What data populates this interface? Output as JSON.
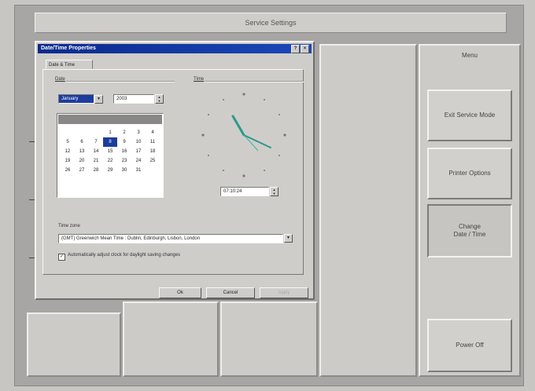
{
  "screen": {
    "title": "Service Settings"
  },
  "right_menu": {
    "header": "Menu",
    "buttons": [
      {
        "id": "exit",
        "label": "Exit Service Mode"
      },
      {
        "id": "printer",
        "label": "Printer Options"
      },
      {
        "id": "datetime",
        "label": "Change\nDate / Time"
      },
      {
        "id": "power",
        "label": "Power Off"
      }
    ]
  },
  "dialog": {
    "title": "Date/Time Properties",
    "controls": {
      "help": "?",
      "close": "×"
    },
    "tab": "Date & Time",
    "date_group": "Date",
    "time_group": "Time",
    "month": "January",
    "year": "2003",
    "calendar": {
      "days": [
        "",
        "",
        "",
        "1",
        "2",
        "3",
        "4",
        "5",
        "6",
        "7",
        "8",
        "9",
        "10",
        "11",
        "12",
        "13",
        "14",
        "15",
        "16",
        "17",
        "18",
        "19",
        "20",
        "21",
        "22",
        "23",
        "24",
        "25",
        "26",
        "27",
        "28",
        "29",
        "30",
        "31"
      ],
      "selected_day": "8"
    },
    "time_value": "07:10:24",
    "timezone_label": "Time zone",
    "timezone_value": "(GMT) Greenwich Mean Time : Dublin, Edinburgh, Lisbon, London",
    "dst_label": "Automatically adjust clock for daylight saving changes",
    "dst_checked": true,
    "buttons": {
      "ok": "Ok",
      "cancel": "Cancel",
      "apply": "Apply"
    }
  },
  "colors": {
    "title_bar": "#0a2a8c",
    "selection": "#1c3c9e",
    "clock_hands": "#2a9a8a"
  },
  "icons": {
    "spin": "spinner-arrows-icon",
    "dropdown": "chevron-down-icon",
    "close": "close-icon"
  }
}
